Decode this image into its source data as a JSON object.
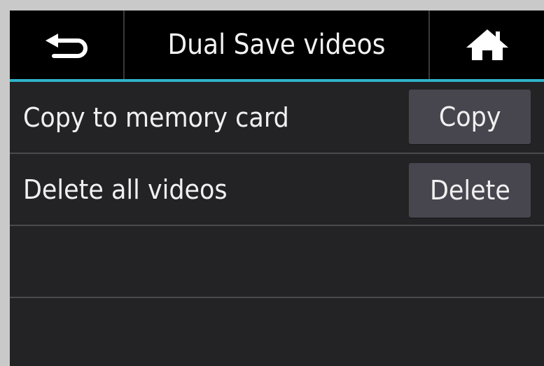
{
  "header": {
    "back_icon": "back-arrow-icon",
    "title": "Dual Save videos",
    "home_icon": "home-icon"
  },
  "rows": [
    {
      "label": "Copy to memory card",
      "button": "Copy"
    },
    {
      "label": "Delete all videos",
      "button": "Delete"
    },
    {
      "label": "",
      "button": ""
    },
    {
      "label": "",
      "button": ""
    }
  ],
  "colors": {
    "accent": "#2fb3c9",
    "background": "#232326",
    "header": "#000000",
    "button": "#47464f"
  }
}
